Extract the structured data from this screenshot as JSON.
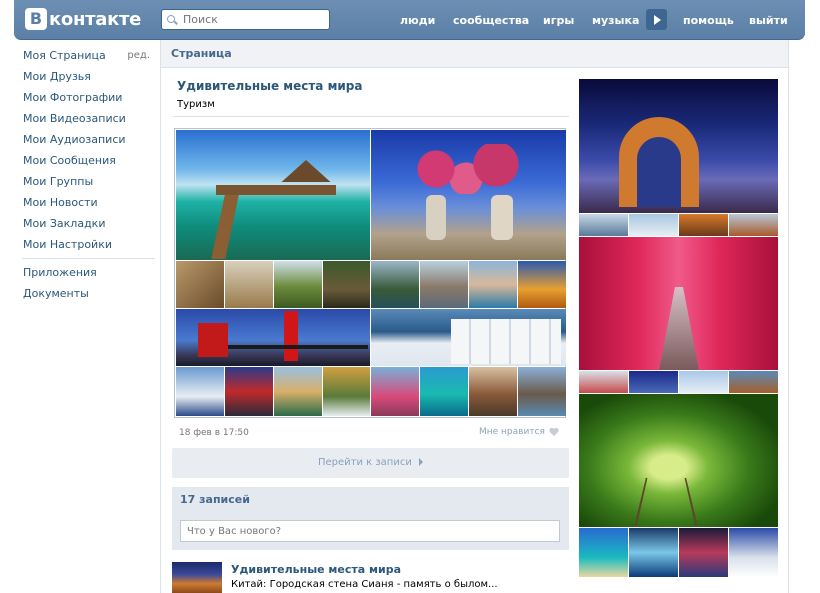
{
  "header": {
    "logo_letter": "В",
    "logo_text": "контакте",
    "search_placeholder": "Поиск",
    "nav": [
      {
        "label": "люди"
      },
      {
        "label": "сообщества"
      },
      {
        "label": "игры"
      },
      {
        "label": "музыка"
      },
      {
        "label": "помощь"
      },
      {
        "label": "выйти"
      }
    ]
  },
  "leftmenu": {
    "items": [
      {
        "label": "Моя Страница"
      },
      {
        "label": "Мои Друзья"
      },
      {
        "label": "Мои Фотографии"
      },
      {
        "label": "Мои Видеозаписи"
      },
      {
        "label": "Мои Аудиозаписи"
      },
      {
        "label": "Мои Сообщения"
      },
      {
        "label": "Мои Группы"
      },
      {
        "label": "Мои Новости"
      },
      {
        "label": "Мои Закладки"
      },
      {
        "label": "Мои Настройки"
      }
    ],
    "edit_label": "ред.",
    "extra": [
      {
        "label": "Приложения"
      },
      {
        "label": "Документы"
      }
    ]
  },
  "main": {
    "heading": "Страница",
    "post": {
      "title": "Удивительные места мира",
      "subtitle": "Туризм",
      "date": "18 фев в 17:50",
      "like_label": "Мне нравится",
      "goto_label": "Перейти к записи"
    },
    "wall": {
      "count_label": "17 записей",
      "input_placeholder": "Что у Вас нового?"
    },
    "wall_post": {
      "title": "Удивительные места мира",
      "text": "Китай: Городская стена Сианя - память о былом..."
    }
  },
  "colors": {
    "header_bg": "#5b7fa6",
    "link": "#2b587a",
    "header_text": "#45688e"
  }
}
